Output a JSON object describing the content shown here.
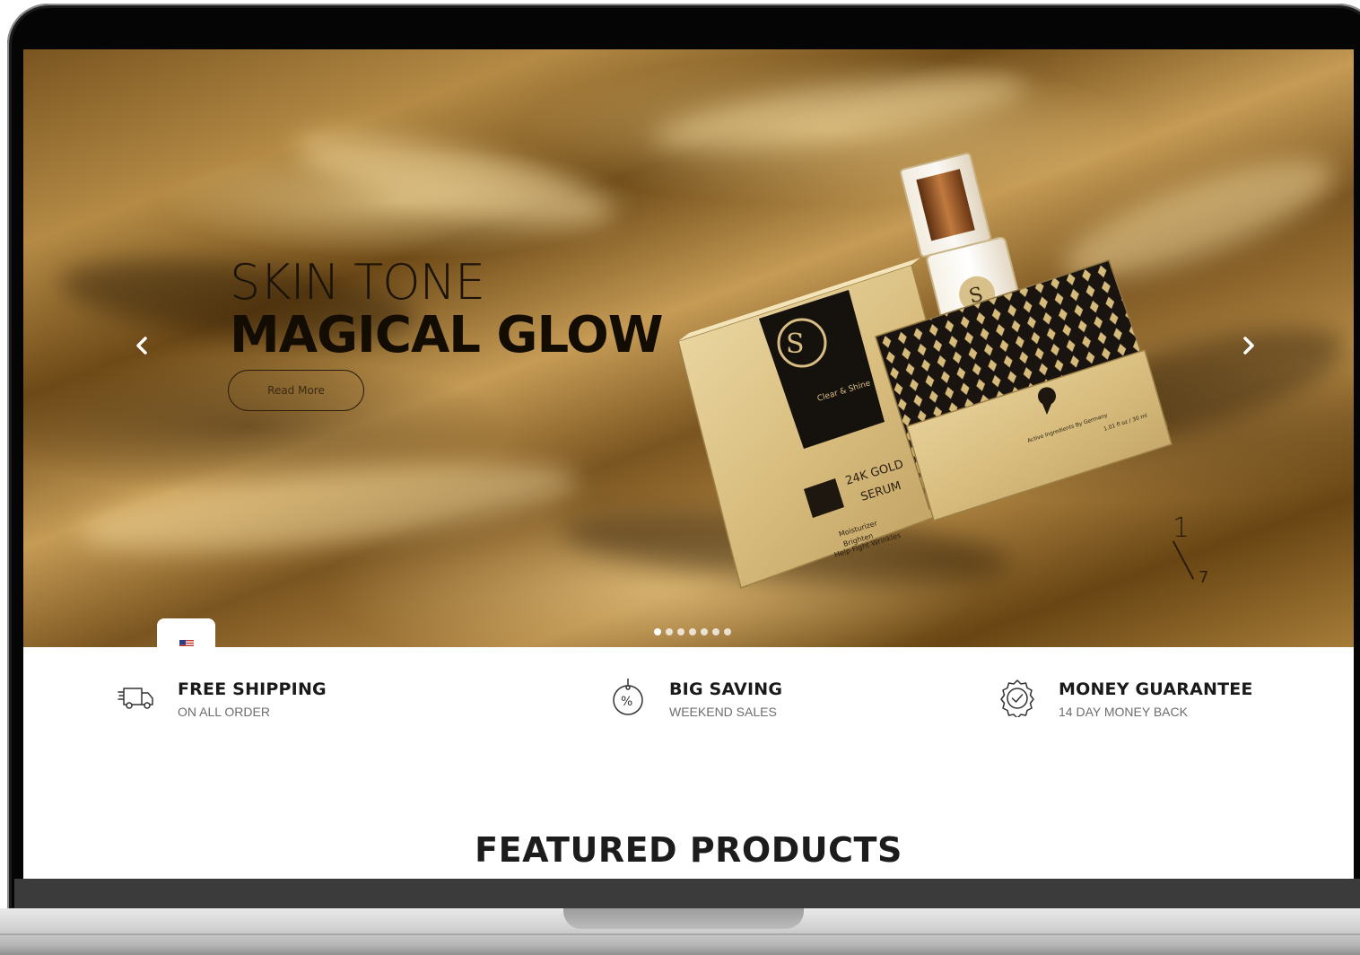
{
  "hero": {
    "title_light": "SKIN TONE",
    "title_bold": "MAGICAL GLOW",
    "cta_label": "Read More",
    "slide_counter": "1",
    "slide_total": "7",
    "slide_count": 7,
    "active_slide": 0,
    "prev_icon": "chevron-left-icon",
    "next_icon": "chevron-right-icon"
  },
  "product": {
    "brand": "Clear & Shine",
    "box_label_line1": "24K GOLD",
    "box_label_line2": "SERUM",
    "box_benefits": [
      "Moisturizer",
      "Brighten",
      "Help Fight Wrinkles"
    ],
    "second_box_text": "Active Ingredients By Germany",
    "volume": "1.01 fl oz / 30 ml"
  },
  "language": {
    "flag_icon": "us-flag-icon"
  },
  "features": [
    {
      "title": "FREE SHIPPING",
      "subtitle": "ON ALL ORDER",
      "icon": "delivery-truck-icon"
    },
    {
      "title": "BIG SAVING",
      "subtitle": "WEEKEND SALES",
      "icon": "discount-tag-icon"
    },
    {
      "title": "MONEY GUARANTEE",
      "subtitle": "14 DAY MONEY BACK",
      "icon": "guarantee-badge-icon"
    }
  ],
  "featured": {
    "title": "FEATURED PRODUCTS"
  },
  "colors": {
    "gold": "#b48a45",
    "dark": "#120c03",
    "text": "#1a1a1a",
    "muted": "#6d6d6d"
  }
}
